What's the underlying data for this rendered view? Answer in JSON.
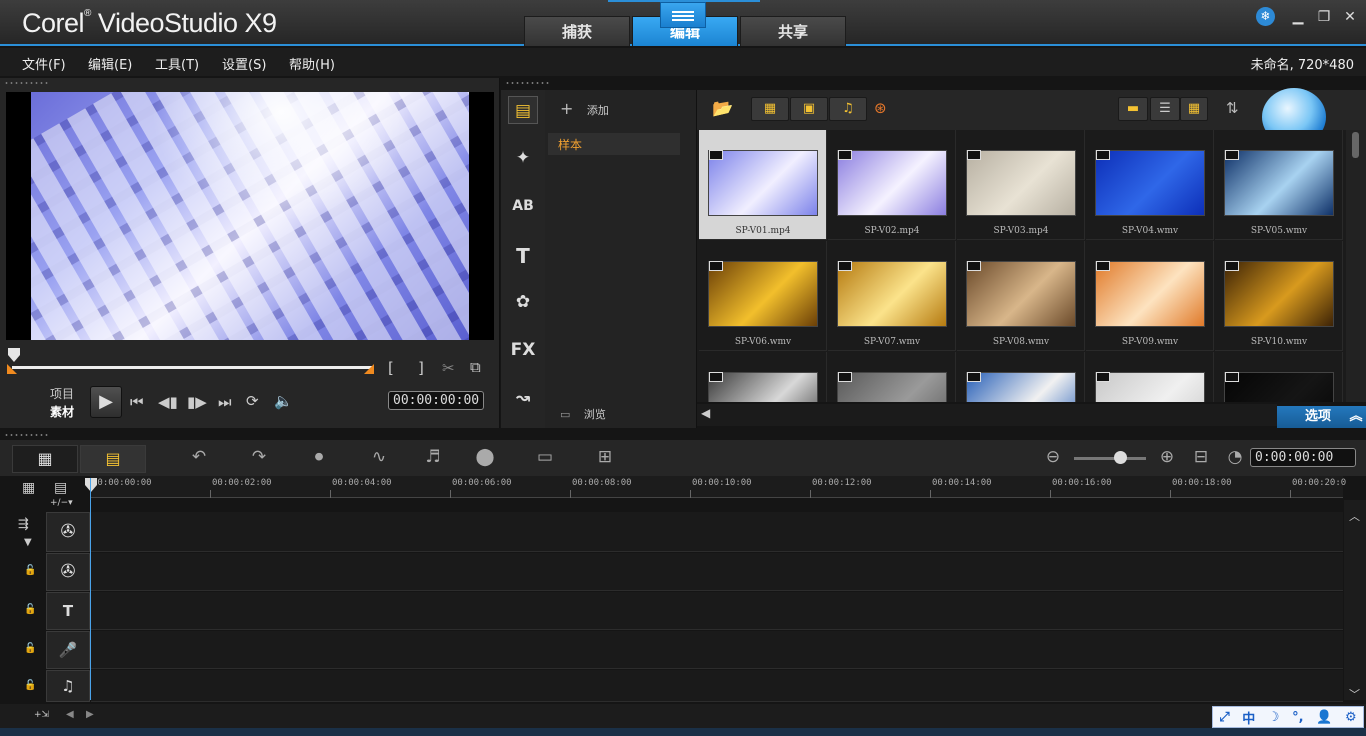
{
  "app": {
    "logo": "Corel VideoStudio X9",
    "logo_main": "Corel",
    "logo_rest": "VideoStudio X9",
    "project_info": "未命名, 720*480"
  },
  "modes": [
    {
      "label": "捕获",
      "active": false
    },
    {
      "label": "编辑",
      "active": true
    },
    {
      "label": "共享",
      "active": false
    }
  ],
  "menu": [
    "文件(F)",
    "编辑(E)",
    "工具(T)",
    "设置(S)",
    "帮助(H)"
  ],
  "player": {
    "mode_project": "项目",
    "mode_clip": "素材",
    "timecode": "00:00:00:00",
    "bracket_in": "[",
    "bracket_out": "]"
  },
  "library": {
    "add_label": "添加",
    "browse_label": "浏览",
    "selected_folder": "样本",
    "options_label": "选项",
    "categories": [
      "media-icon",
      "instant-project-icon",
      "transition-icon",
      "title-icon",
      "graphic-icon",
      "filter-icon",
      "path-icon"
    ],
    "filter_text": "FX",
    "title_text": "T",
    "transition_text": "AB",
    "thumbnails": [
      {
        "name": "SP-V01.mp4",
        "color1": "#7c82ea",
        "color2": "#f1efff",
        "selected": true
      },
      {
        "name": "SP-V02.mp4",
        "color1": "#8b7ee0",
        "color2": "#f5f2ff",
        "selected": false
      },
      {
        "name": "SP-V03.mp4",
        "color1": "#b7b0a2",
        "color2": "#e8e2d4",
        "selected": false
      },
      {
        "name": "SP-V04.wmv",
        "color1": "#0d2fb8",
        "color2": "#2f67e8",
        "selected": false
      },
      {
        "name": "SP-V05.wmv",
        "color1": "#0f3168",
        "color2": "#a8d2f0",
        "selected": false
      },
      {
        "name": "SP-V06.wmv",
        "color1": "#6b3f07",
        "color2": "#f2bf2c",
        "selected": false
      },
      {
        "name": "SP-V07.wmv",
        "color1": "#b57a10",
        "color2": "#fbe38b",
        "selected": false
      },
      {
        "name": "SP-V08.wmv",
        "color1": "#6b4a2a",
        "color2": "#d8b68a",
        "selected": false
      },
      {
        "name": "SP-V09.wmv",
        "color1": "#e07a2a",
        "color2": "#fde3c0",
        "selected": false
      },
      {
        "name": "SP-V10.wmv",
        "color1": "#3d2306",
        "color2": "#d89a1e",
        "selected": false
      },
      {
        "name": "",
        "color1": "#3b3b3b",
        "color2": "#d8d8d8",
        "selected": false
      },
      {
        "name": "",
        "color1": "#5a5a5a",
        "color2": "#9a9a9a",
        "selected": false
      },
      {
        "name": "",
        "color1": "#2860b8",
        "color2": "#f1f1f1",
        "selected": false
      },
      {
        "name": "",
        "color1": "#c8c8c8",
        "color2": "#f0f0f0",
        "selected": false
      },
      {
        "name": "",
        "color1": "#050505",
        "color2": "#151515",
        "selected": false
      }
    ]
  },
  "timeline": {
    "ruler": [
      "00:00:00:00",
      "00:00:02:00",
      "00:00:04:00",
      "00:00:06:00",
      "00:00:08:00",
      "00:00:10:00",
      "00:00:12:00",
      "00:00:14:00",
      "00:00:16:00",
      "00:00:18:00",
      "00:00:20:0"
    ],
    "timecode": "0:00:00:00",
    "tracks": [
      "video-track-icon",
      "overlay-track-icon",
      "title-track-icon",
      "voice-track-icon",
      "music-track-icon"
    ],
    "title_track_text": "T"
  },
  "ime": {
    "lang": "中"
  },
  "colors": {
    "accent": "#2b8fd8",
    "highlight": "#f4c232",
    "folder": "#f0a030",
    "marker": "#f08a1f"
  }
}
